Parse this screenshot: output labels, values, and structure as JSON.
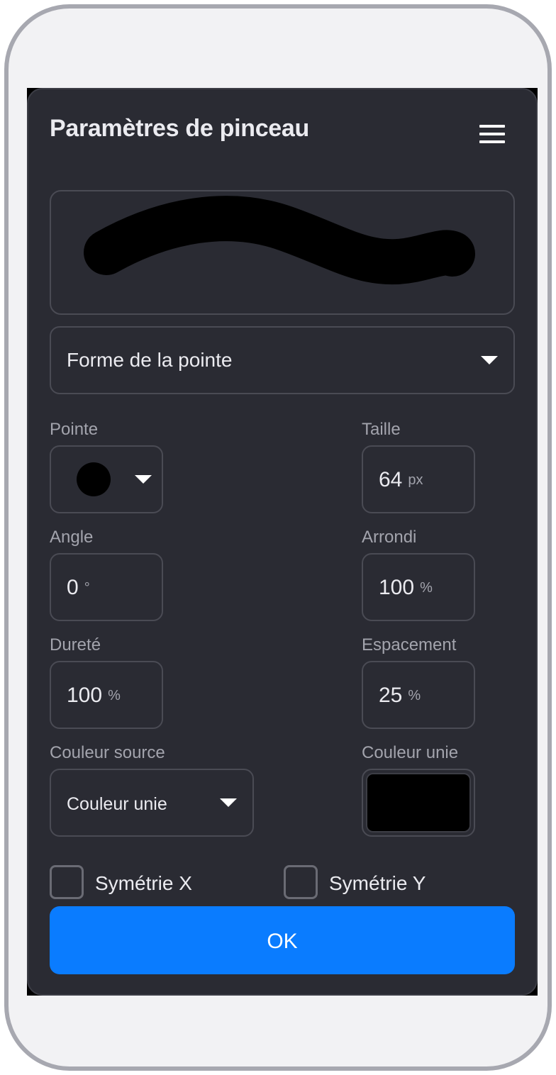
{
  "dialog": {
    "title": "Paramètres de pinceau",
    "menu_icon": "hamburger-menu-icon",
    "preview_icon": "brush-stroke-preview"
  },
  "brush_section": {
    "dropdown_label": "Forme de la pointe",
    "dropdown_icon": "caret-down-icon"
  },
  "fields": {
    "tip": {
      "label": "Pointe",
      "shape_icon": "round-tip-icon"
    },
    "size": {
      "label": "Taille",
      "value": "64",
      "unit": "px"
    },
    "angle": {
      "label": "Angle",
      "value": "0",
      "unit": "°"
    },
    "roundness": {
      "label": "Arrondi",
      "value": "100",
      "unit": "%"
    },
    "hardness": {
      "label": "Dureté",
      "value": "100",
      "unit": "%"
    },
    "spacing": {
      "label": "Espacement",
      "value": "25",
      "unit": "%"
    },
    "color_source": {
      "label": "Couleur source",
      "value": "Couleur unie"
    },
    "solid_color": {
      "label": "Couleur unie",
      "color": "#000000"
    }
  },
  "symmetry": {
    "x_label": "Symétrie X",
    "y_label": "Symétrie Y",
    "x_checked": false,
    "y_checked": false
  },
  "actions": {
    "ok_label": "OK"
  },
  "colors": {
    "panel_bg": "#2a2b33",
    "accent": "#0a7cff",
    "text": "#ebebf0",
    "muted_text": "#a3a4ad"
  }
}
